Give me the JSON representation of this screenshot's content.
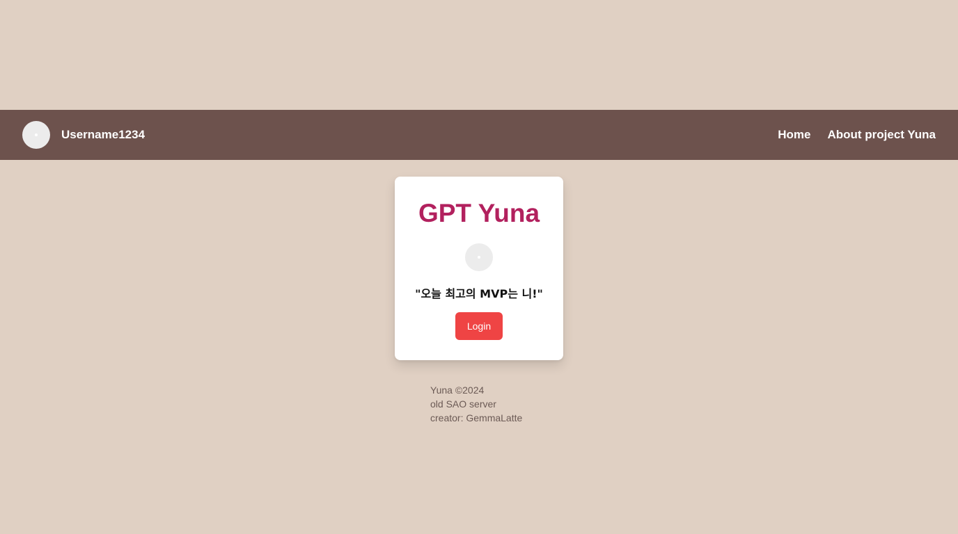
{
  "header": {
    "username": "Username1234",
    "nav": [
      {
        "label": "Home"
      },
      {
        "label": "About project Yuna"
      }
    ]
  },
  "card": {
    "title": "GPT Yuna",
    "quote": "\"오늘 최고의 MVP는 니!\"",
    "login_label": "Login"
  },
  "footer": {
    "lines": [
      "Yuna ©2024",
      "old SAO server",
      "creator: GemmaLatte"
    ]
  },
  "colors": {
    "background": "#e0d0c3",
    "navbar": "#6d524d",
    "title": "#b2215e",
    "login_button": "#ef4444"
  }
}
